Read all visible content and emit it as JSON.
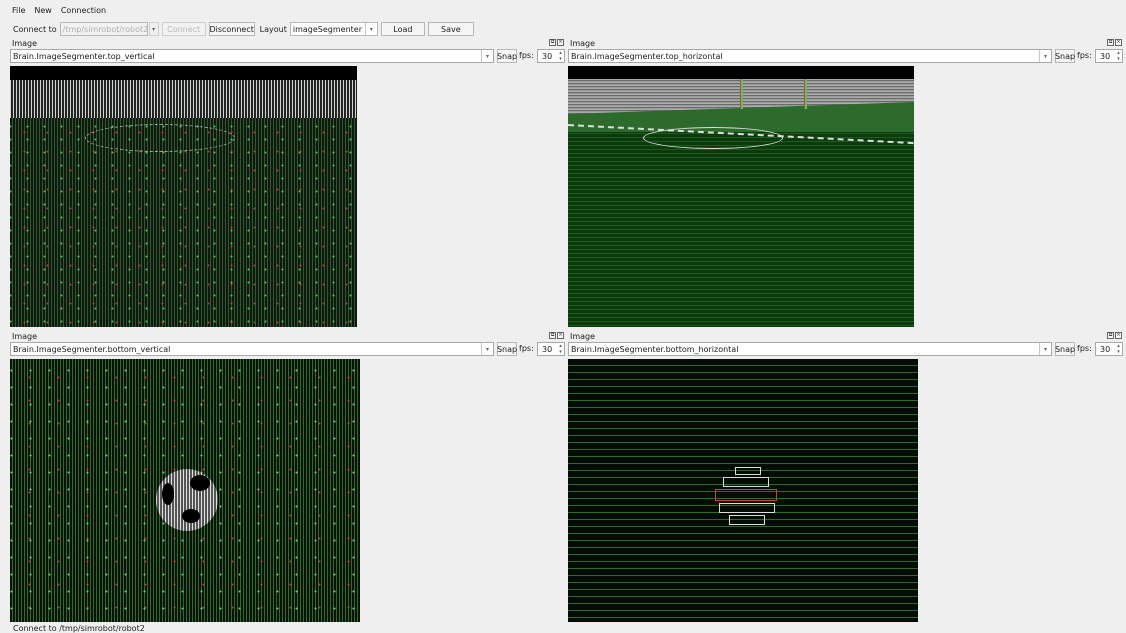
{
  "menu": [
    "File",
    "New",
    "Connection"
  ],
  "toolbar": {
    "connect_to_label": "Connect to",
    "connect_path": "/tmp/simrobot/robot2",
    "connect_button": "Connect",
    "disconnect_button": "Disconnect",
    "layout_label": "Layout",
    "layout_value": "imageSegmenter",
    "load_button": "Load",
    "save_button": "Save"
  },
  "panels": [
    {
      "title": "Image",
      "view": "Brain.ImageSegmenter.top_vertical",
      "snap": "Snap",
      "fps_label": "fps:",
      "fps": "30"
    },
    {
      "title": "Image",
      "view": "Brain.ImageSegmenter.top_horizontal",
      "snap": "Snap",
      "fps_label": "fps:",
      "fps": "30"
    },
    {
      "title": "Image",
      "view": "Brain.ImageSegmenter.bottom_vertical",
      "snap": "Snap",
      "fps_label": "fps:",
      "fps": "30"
    },
    {
      "title": "Image",
      "view": "Brain.ImageSegmenter.bottom_horizontal",
      "snap": "Snap",
      "fps_label": "fps:",
      "fps": "30"
    }
  ],
  "statusbar": "Connect to /tmp/simrobot/robot2"
}
